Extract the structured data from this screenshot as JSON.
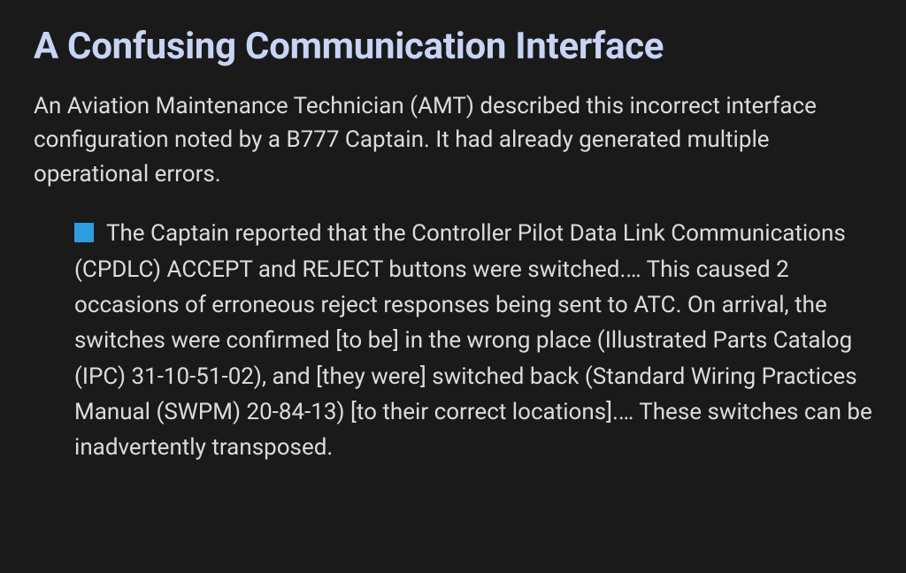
{
  "article": {
    "heading": "A Confusing Communication Interface",
    "intro": "An Aviation Maintenance Technician (AMT) described this incorrect interface configuration noted by a B777 Captain. It had already generated multiple operational errors.",
    "bullet_icon": "square-bullet",
    "body": "The Captain reported that the Controller Pilot Data Link Communications (CPDLC) ACCEPT and REJECT buttons were switched.… This caused 2 occasions of erroneous reject responses being sent to ATC. On arrival, the switches were confirmed [to be] in the wrong place (Illustrated Parts Catalog (IPC) 31-10-51-02), and [they were] switched back (Standard Wiring Practices Manual (SWPM) 20-84-13) [to their correct locations].… These switches can be inadvertently transposed."
  },
  "colors": {
    "background": "#1a1a1a",
    "heading": "#c8d4f5",
    "body_text": "#dcdcdc",
    "bullet": "#2f9be0"
  }
}
